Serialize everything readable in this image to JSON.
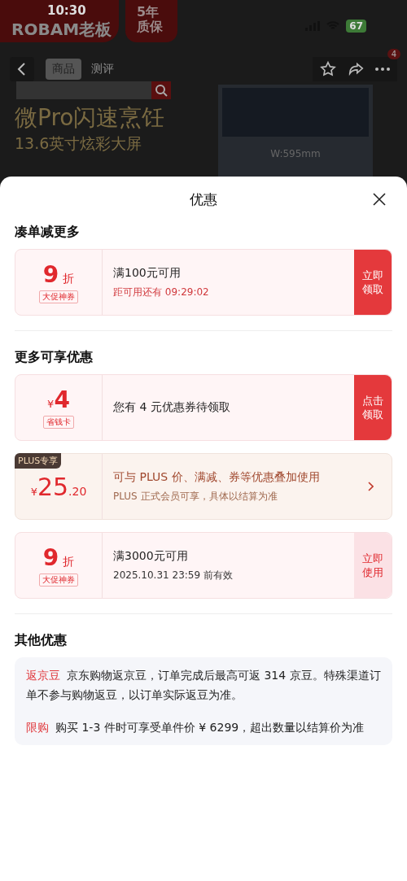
{
  "status_bar": {
    "time": "10:30",
    "battery": "67"
  },
  "background_page": {
    "brand": "ROBAM老板",
    "warranty": "5年质保",
    "tabs": [
      {
        "label": "商品",
        "selected": true
      },
      {
        "label": "测评",
        "selected": false
      }
    ],
    "cart_badge": "4",
    "headline": "微Pro闪速烹饪",
    "subheadline": "13.6英寸炫彩大屏",
    "dimension": "W:595mm"
  },
  "sheet": {
    "title": "优惠",
    "sections": [
      {
        "title": "凑单减更多",
        "coupons": [
          {
            "kind": "discount",
            "value": "9",
            "unit": "折",
            "tag": "大促神券",
            "title": "满100元可用",
            "subtitle": "距可用还有 09:29:02",
            "subtitle_alert": true,
            "action": "立即领取",
            "action_filled": true
          }
        ]
      },
      {
        "title": "更多可享优惠",
        "coupons": [
          {
            "kind": "cash",
            "prefix": "¥",
            "value": "4",
            "tag": "省钱卡",
            "title": "您有 4 元优惠券待领取",
            "action": "点击领取",
            "action_filled": true
          },
          {
            "kind": "plus",
            "badge": "PLUS专享",
            "prefix": "¥",
            "value": "25",
            "decimal": ".20",
            "title": "可与 PLUS 价、满减、券等优惠叠加使用",
            "subtitle": "PLUS 正式会员可享，具体以结算为准"
          },
          {
            "kind": "discount",
            "value": "9",
            "unit": "折",
            "tag": "大促神券",
            "title": "满3000元可用",
            "subtitle": "2025.10.31 23:59 前有效",
            "subtitle_alert": false,
            "action": "立即使用",
            "action_filled": false
          }
        ]
      }
    ],
    "other": {
      "title": "其他优惠",
      "items": [
        {
          "tag": "返京豆",
          "text": "京东购物返京豆，订单完成后最高可返 314 京豆。特殊渠道订单不参与购物返豆，以订单实际返豆为准。"
        },
        {
          "tag": "限购",
          "text": "购买 1-3 件时可享受单件价 ¥ 6299，超出数量以结算价为准"
        }
      ]
    }
  }
}
